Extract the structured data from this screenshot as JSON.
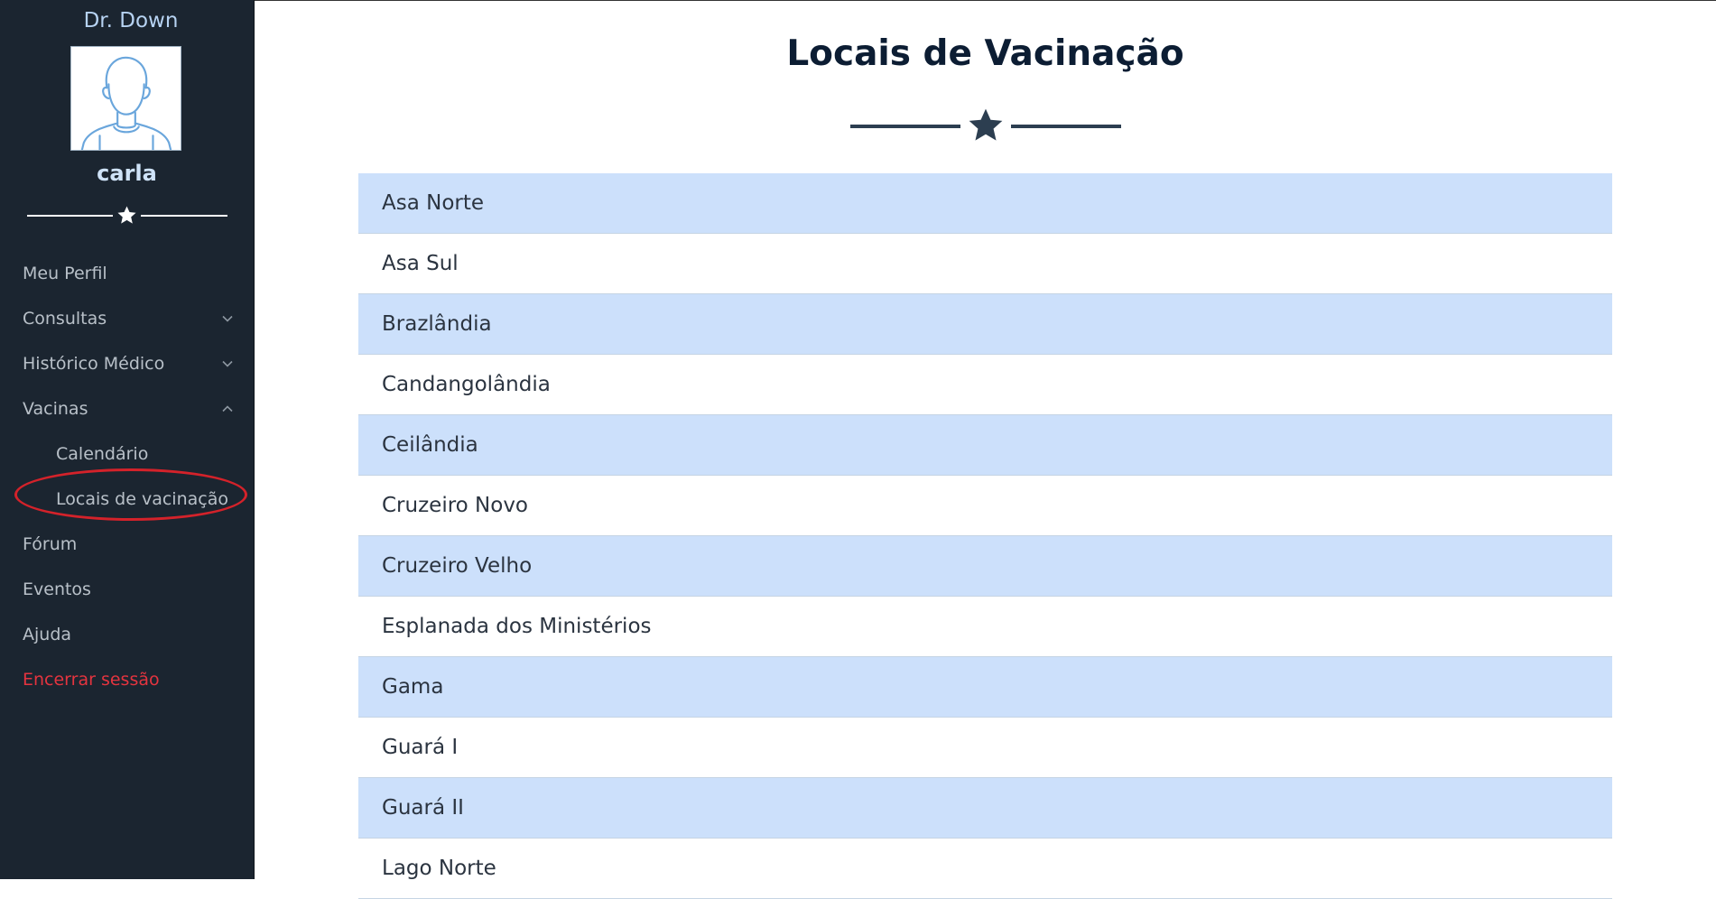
{
  "sidebar": {
    "brand": "Dr. Down",
    "username": "carla",
    "nav": {
      "meu_perfil": "Meu Perfil",
      "consultas": "Consultas",
      "historico": "Histórico Médico",
      "vacinas": "Vacinas",
      "calendario": "Calendário",
      "locais": "Locais de vacinação",
      "forum": "Fórum",
      "eventos": "Eventos",
      "ajuda": "Ajuda",
      "logout": "Encerrar sessão"
    }
  },
  "main": {
    "title": "Locais de Vacinação",
    "locations": [
      "Asa Norte",
      "Asa Sul",
      "Brazlândia",
      "Candangolândia",
      "Ceilândia",
      "Cruzeiro Novo",
      "Cruzeiro Velho",
      "Esplanada dos Ministérios",
      "Gama",
      "Guará I",
      "Guará II",
      "Lago Norte"
    ]
  },
  "colors": {
    "sidebar_bg": "#1b2530",
    "row_highlight": "#cce0fb",
    "title": "#0c1d33",
    "logout": "#e4343f",
    "annotation": "#d4222a"
  }
}
